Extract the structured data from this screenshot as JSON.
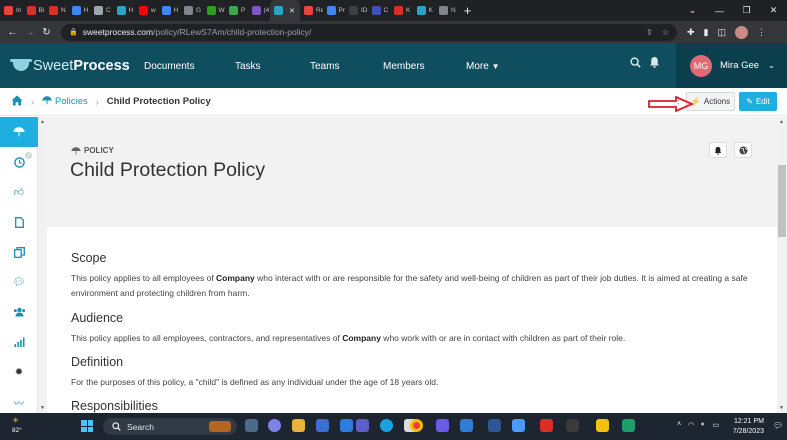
{
  "browser": {
    "tabs": [
      {
        "label": "In",
        "color": "#ea4335"
      },
      {
        "label": "Bi",
        "color": "#d93025"
      },
      {
        "label": "N",
        "color": "#d93025"
      },
      {
        "label": "H",
        "color": "#4285f4"
      },
      {
        "label": "C",
        "color": "#9ba7ad"
      },
      {
        "label": "H",
        "color": "#2aa3c4"
      },
      {
        "label": "w",
        "color": "#ff0000"
      },
      {
        "label": "H",
        "color": "#4285f4"
      },
      {
        "label": "G",
        "color": "#80868b"
      },
      {
        "label": "W",
        "color": "#2ca01c"
      },
      {
        "label": "P",
        "color": "#34a853"
      },
      {
        "label": "(4",
        "color": "#7e57c2"
      },
      {
        "label": "",
        "color": "#2aa3c4",
        "active": true
      },
      {
        "label": "Re",
        "color": "#e8453c"
      },
      {
        "label": "Pr",
        "color": "#4285f4"
      },
      {
        "label": "ID",
        "color": "#3c4043"
      },
      {
        "label": "C",
        "color": "#3f51b5"
      },
      {
        "label": "K",
        "color": "#d93025"
      },
      {
        "label": "K",
        "color": "#2aa3c4"
      },
      {
        "label": "N",
        "color": "#80868b"
      }
    ],
    "close_tab_glyph": "✕",
    "new_tab_glyph": "+",
    "url_host": "sweetprocess.com",
    "url_path": "/policy/RLewS7Am/child-protection-policy/"
  },
  "app": {
    "logo_sweet": "Sweet",
    "logo_process": "Process",
    "nav": [
      "Documents",
      "Tasks",
      "Teams",
      "Members",
      "More"
    ],
    "user_initials": "MG",
    "user_name": "Mira Gee"
  },
  "breadcrumb": {
    "section": "Policies",
    "current": "Child Protection Policy"
  },
  "toolbar": {
    "actions_label": "Actions",
    "edit_label": "Edit"
  },
  "sidebar": {
    "badge": "2",
    "items": [
      "umbrella-icon",
      "clock-icon",
      "thumbs-up-icon",
      "file-icon",
      "copy-icon",
      "comments-icon",
      "users-icon",
      "bar-chart-icon",
      "gear-icon",
      "flow-icon"
    ]
  },
  "doc": {
    "tag": "POLICY",
    "title": "Child Protection Policy",
    "sections": [
      {
        "heading": "Scope",
        "text_before": "This policy applies to all employees of ",
        "bold": "Company",
        "text_after": " who interact with or are responsible for the safety and well-being of children as part of their job duties. It is aimed at creating a safe environment and protecting children from harm."
      },
      {
        "heading": "Audience",
        "text_before": "This policy applies to all employees, contractors, and representatives of ",
        "bold": "Company",
        "text_after": " who work with or are in contact with children as part of their role."
      },
      {
        "heading": "Definition",
        "text_before": "For the purposes of this policy, a \"child\" is defined as any individual under the age of 18 years old.",
        "bold": "",
        "text_after": ""
      },
      {
        "heading": "Responsibilities",
        "text_before": "",
        "bold": "",
        "text_after": ""
      }
    ]
  },
  "taskbar": {
    "temperature": "82°",
    "search_label": "Search",
    "time": "12:21 PM",
    "date": "7/28/2023"
  },
  "colors": {
    "brand_dark": "#0f4e5e",
    "accent": "#1eaee0",
    "annotation_arrow": "#e0192b"
  }
}
